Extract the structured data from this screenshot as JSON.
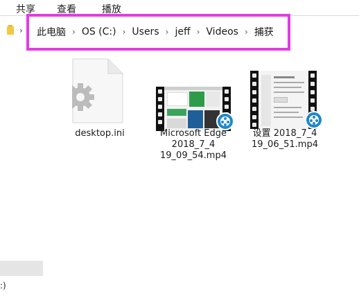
{
  "ribbon": {
    "tabs": [
      {
        "label": "共享"
      },
      {
        "label": "查看"
      },
      {
        "label": "播放"
      }
    ]
  },
  "address_bar": {
    "breadcrumb": [
      "此电脑",
      "OS (C:)",
      "Users",
      "jeff",
      "Videos",
      "捕获"
    ],
    "separator": "›",
    "highlight_color": "#e43be3"
  },
  "nav_pane": {
    "drive_label": ":)"
  },
  "files": [
    {
      "name": "desktop.ini",
      "icon": "gear-settings-file-icon"
    },
    {
      "name_lines": [
        "Microsoft Edge",
        "2018_7_4",
        "19_09_54.mp4"
      ],
      "icon": "video-thumbnail"
    },
    {
      "name_lines": [
        "设置 2018_7_4",
        "19_06_51.mp4"
      ],
      "icon": "video-thumbnail"
    }
  ],
  "colors": {
    "badge": "#1e88c8",
    "folder": "#f3c643",
    "selection": "#e5e5e5"
  }
}
